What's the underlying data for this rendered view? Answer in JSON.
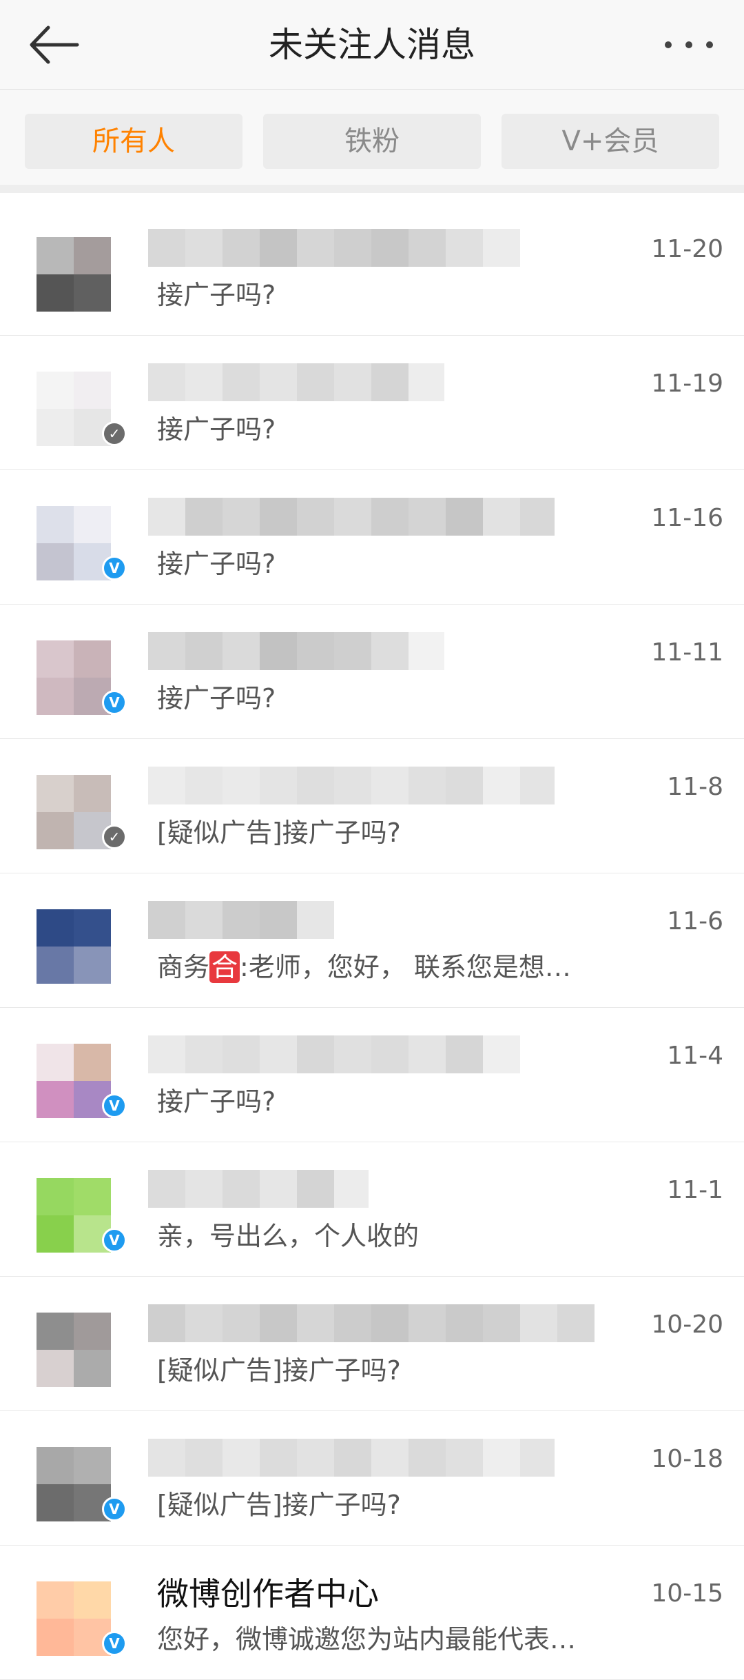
{
  "header": {
    "title": "未关注人消息",
    "back_icon": "arrow-left-icon",
    "more_icon": "more-dots-icon"
  },
  "tabs": [
    {
      "label": "所有人",
      "active": true
    },
    {
      "label": "铁粉",
      "active": false
    },
    {
      "label": "V+会员",
      "active": false
    }
  ],
  "colors": {
    "accent": "#ff8200",
    "verified_blue": "#1e9bf0",
    "tag_red": "#e8393e"
  },
  "messages": [
    {
      "date": "11-20",
      "preview": "接广子吗?"
    },
    {
      "date": "11-19",
      "preview": "接广子吗?"
    },
    {
      "date": "11-16",
      "preview": "接广子吗?"
    },
    {
      "date": "11-11",
      "preview": "接广子吗?"
    },
    {
      "date": "11-8",
      "preview": "[疑似广告]接广子吗?"
    },
    {
      "date": "11-6",
      "preview_pre": "商务",
      "preview_tag": "合",
      "preview_post": ":老师，您好， 联系您是想…"
    },
    {
      "date": "11-4",
      "preview": "接广子吗?"
    },
    {
      "date": "11-1",
      "preview": "亲，号出么，个人收的"
    },
    {
      "date": "10-20",
      "preview": "[疑似广告]接广子吗?"
    },
    {
      "date": "10-18",
      "preview": "[疑似广告]接广子吗?"
    },
    {
      "date": "10-15",
      "name": "微博创作者中心",
      "preview": "您好，微博诚邀您为站内最能代表…"
    }
  ]
}
